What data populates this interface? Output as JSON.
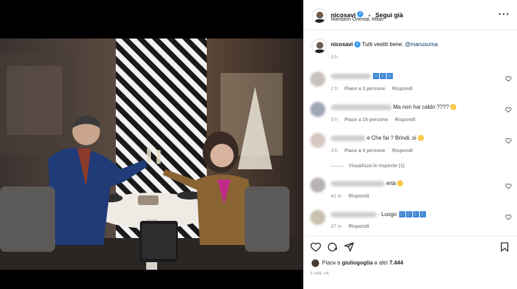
{
  "post": {
    "username": "nicosavi",
    "follow_separator": "•",
    "follow_label": "Segui già",
    "location": "Mandarin Oriental, Milan",
    "more_label": "···",
    "caption_text": "Tutti vestiti bene.",
    "caption_mention": "@manusuma",
    "caption_time": "3 h"
  },
  "comments": [
    {
      "text": "",
      "icons": [
        "⚓",
        "⚓",
        "⚓"
      ],
      "time": "2 h",
      "likes": "Piace a 3 persone",
      "reply": "Rispondi"
    },
    {
      "text": "Ma non hai caldo ????",
      "icons": [],
      "face": true,
      "time": "3 h",
      "likes": "Piace a 15 persone",
      "reply": "Rispondi"
    },
    {
      "text": "e Che fai ? Brindi..si",
      "icons": [],
      "face": true,
      "time": "3 h",
      "likes": "Piace a 3 persone",
      "reply": "Rispondi"
    },
    {
      "text": "ertà",
      "icons": [],
      "face": true,
      "time": "42 m",
      "likes": "",
      "reply": "Rispondi"
    },
    {
      "text": "· Luogo",
      "icons": [
        "⚓",
        "⚓",
        "⚓",
        "⚓"
      ],
      "time": "37 m",
      "likes": "",
      "reply": "Rispondi"
    }
  ],
  "view_replies": "Visualizza le risposte (1)",
  "footer": {
    "likes_prefix": "Piace a",
    "likes_user": "giuliogoglia",
    "likes_suffix": "e altri",
    "likes_count": "7.444",
    "time_ago": "3 ORE FA"
  },
  "icons": {
    "verified": "verified-badge-icon",
    "heart": "heart-icon",
    "comment": "comment-icon",
    "share": "share-icon",
    "save": "bookmark-icon"
  },
  "colors": {
    "verified_blue": "#3897f0",
    "mention_blue": "#00376b"
  }
}
